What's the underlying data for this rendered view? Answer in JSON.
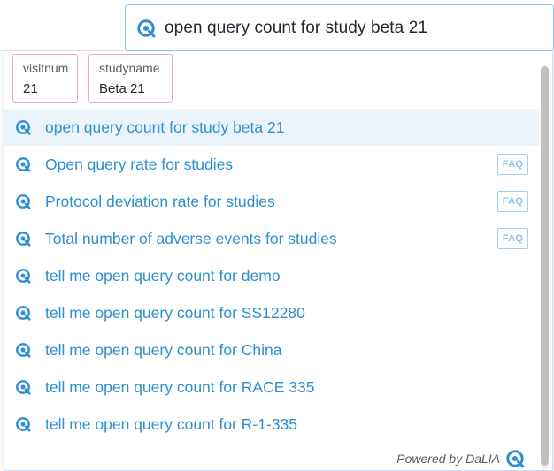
{
  "search": {
    "query": "open query count for study beta 21",
    "icon": "dalia-logo-icon"
  },
  "chips": [
    {
      "label": "visitnum",
      "value": "21"
    },
    {
      "label": "studyname",
      "value": "Beta 21"
    }
  ],
  "suggestions": [
    {
      "text": "open query count for study beta 21",
      "badge": ""
    },
    {
      "text": "Open query rate for studies",
      "badge": "FAQ"
    },
    {
      "text": "Protocol deviation rate for studies",
      "badge": "FAQ"
    },
    {
      "text": "Total number of adverse events for studies",
      "badge": "FAQ"
    },
    {
      "text": "tell me open query count for demo",
      "badge": ""
    },
    {
      "text": "tell me open query count for SS12280",
      "badge": ""
    },
    {
      "text": "tell me open query count for China",
      "badge": ""
    },
    {
      "text": "tell me open query count for RACE 335",
      "badge": ""
    },
    {
      "text": "tell me open query count for R-1-335",
      "badge": ""
    }
  ],
  "footer": {
    "powered_by": "Powered by DaLIA"
  },
  "colors": {
    "accent": "#2d8fd0",
    "highlight_row": "#ecf4fb",
    "chip_border": "#e6a8cf",
    "faq_border": "#9fd0ee"
  }
}
